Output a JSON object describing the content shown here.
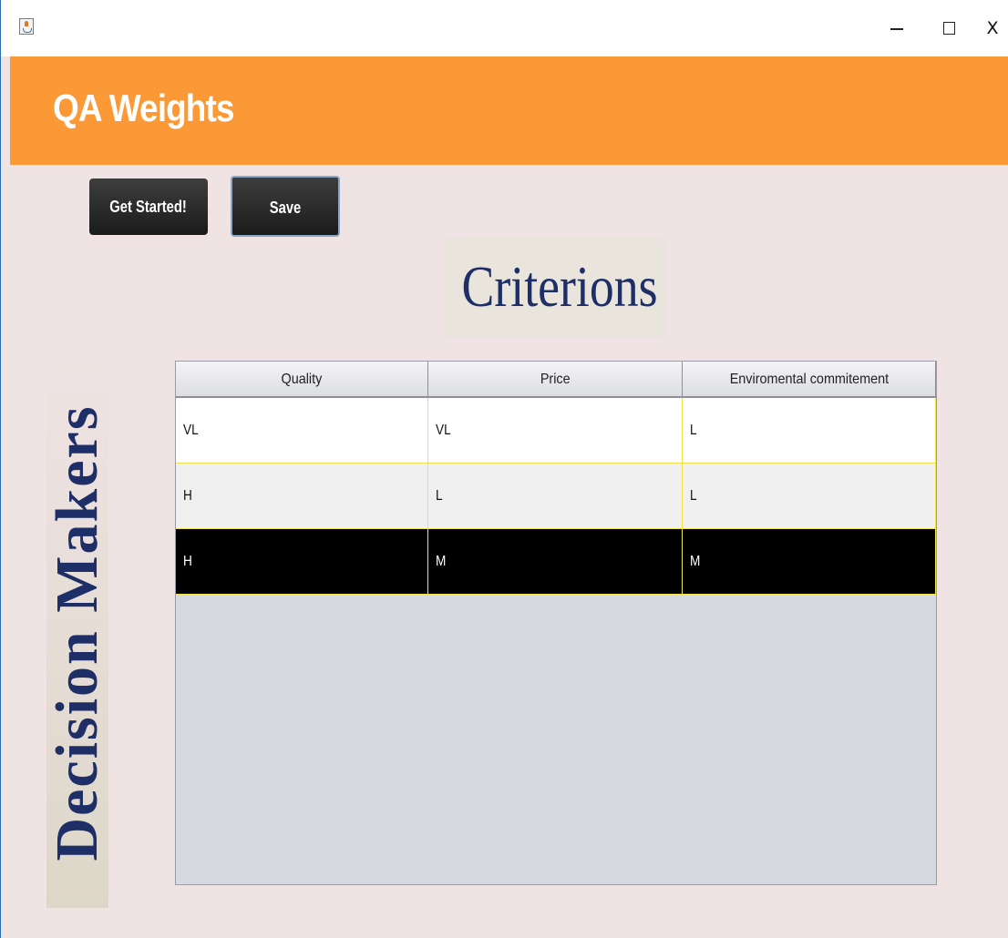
{
  "window": {
    "icon": "java-cup-icon",
    "controls": {
      "minimize": "minimize-icon",
      "maximize": "maximize-icon",
      "close": "X"
    }
  },
  "header": {
    "title": "QA Weights",
    "bg_color": "#fb9937"
  },
  "toolbar": {
    "get_started_label": "Get Started!",
    "save_label": "Save"
  },
  "criteria_heading": "Criterions",
  "decision_makers_heading": "Decision Makers",
  "table": {
    "columns": [
      "Quality",
      "Price",
      "Enviromental commitement"
    ],
    "rows": [
      [
        "VL",
        "VL",
        "L"
      ],
      [
        "H",
        "L",
        "L"
      ],
      [
        "H",
        "M",
        "M"
      ]
    ],
    "selected_row": 2,
    "grid_color": "#f2e24a"
  }
}
